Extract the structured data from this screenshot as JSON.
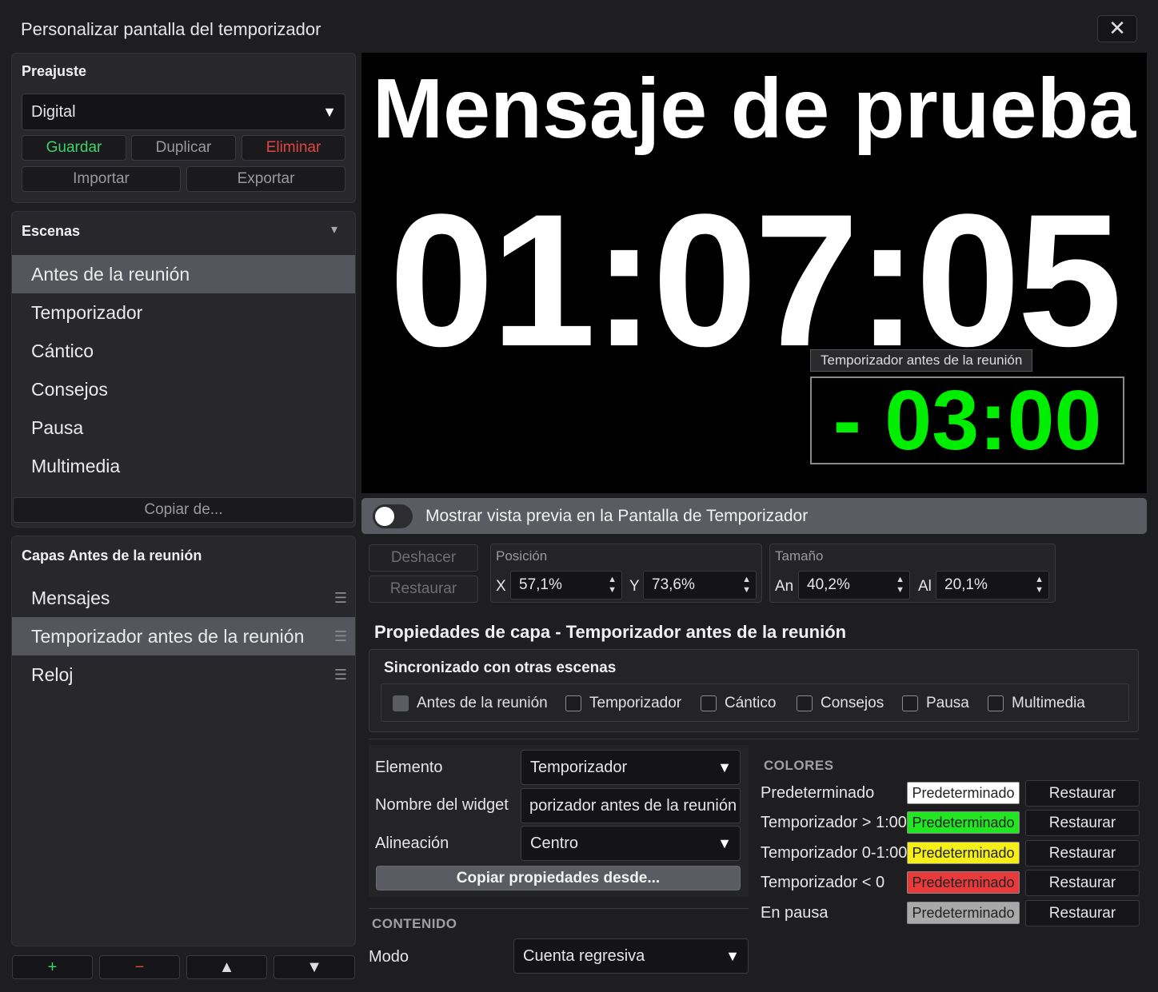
{
  "window": {
    "title": "Personalizar pantalla del temporizador",
    "close_glyph": "✕"
  },
  "preset": {
    "title": "Preajuste",
    "selected": "Digital",
    "save": "Guardar",
    "duplicate": "Duplicar",
    "delete": "Eliminar",
    "import": "Importar",
    "export": "Exportar"
  },
  "scenes": {
    "title": "Escenas",
    "collapse_glyph": "▾",
    "items": [
      "Antes de la reunión",
      "Temporizador",
      "Cántico",
      "Consejos",
      "Pausa",
      "Multimedia"
    ],
    "selected_index": 0,
    "copy_from": "Copiar de..."
  },
  "layers": {
    "title": "Capas Antes de la reunión",
    "items": [
      "Mensajes",
      "Temporizador antes de la reunión",
      "Reloj"
    ],
    "selected_index": 1,
    "add": "+",
    "remove": "−",
    "up": "▲",
    "down": "▼"
  },
  "preview": {
    "message": "Mensaje de prueba",
    "clock": "01:07:05",
    "widget_label": "Temporizador antes de la reunión",
    "countdown": "- 03:00",
    "countdown_color": "#00ee00"
  },
  "toggle": {
    "label": "Mostrar vista previa en la Pantalla de Temporizador",
    "on": false
  },
  "edit": {
    "undo": "Deshacer",
    "restore": "Restaurar"
  },
  "position": {
    "title": "Posición",
    "x_label": "X",
    "x_value": "57,1%",
    "y_label": "Y",
    "y_value": "73,6%"
  },
  "size": {
    "title": "Tamaño",
    "w_label": "An",
    "w_value": "40,2%",
    "h_label": "Al",
    "h_value": "20,1%"
  },
  "layer_props": {
    "title": "Propiedades de capa - Temporizador antes de la reunión",
    "sync_title": "Sincronizado con otras escenas",
    "sync_items": [
      "Antes de la reunión",
      "Temporizador",
      "Cántico",
      "Consejos",
      "Pausa",
      "Multimedia"
    ]
  },
  "element": {
    "element_label": "Elemento",
    "element_value": "Temporizador",
    "widget_name_label": "Nombre del widget",
    "widget_name_value": "porizador antes de la reunión",
    "align_label": "Alineación",
    "align_value": "Centro",
    "copy_props": "Copiar propiedades desde..."
  },
  "content": {
    "title": "CONTENIDO",
    "mode_label": "Modo",
    "mode_value": "Cuenta regresiva"
  },
  "colors": {
    "title": "COLORES",
    "rows": [
      {
        "label": "Predeterminado",
        "swatch_text": "Predeterminado",
        "color": "#ffffff",
        "restore": "Restaurar"
      },
      {
        "label": "Temporizador > 1:00",
        "swatch_text": "Predeterminado",
        "color": "#22e622",
        "restore": "Restaurar"
      },
      {
        "label": "Temporizador 0-1:00",
        "swatch_text": "Predeterminado",
        "color": "#f6ee19",
        "restore": "Restaurar"
      },
      {
        "label": "Temporizador < 0",
        "swatch_text": "Predeterminado",
        "color": "#e83a3a",
        "restore": "Restaurar"
      },
      {
        "label": "En pausa",
        "swatch_text": "Predeterminado",
        "color": "#a9a9a9",
        "restore": "Restaurar"
      }
    ]
  }
}
